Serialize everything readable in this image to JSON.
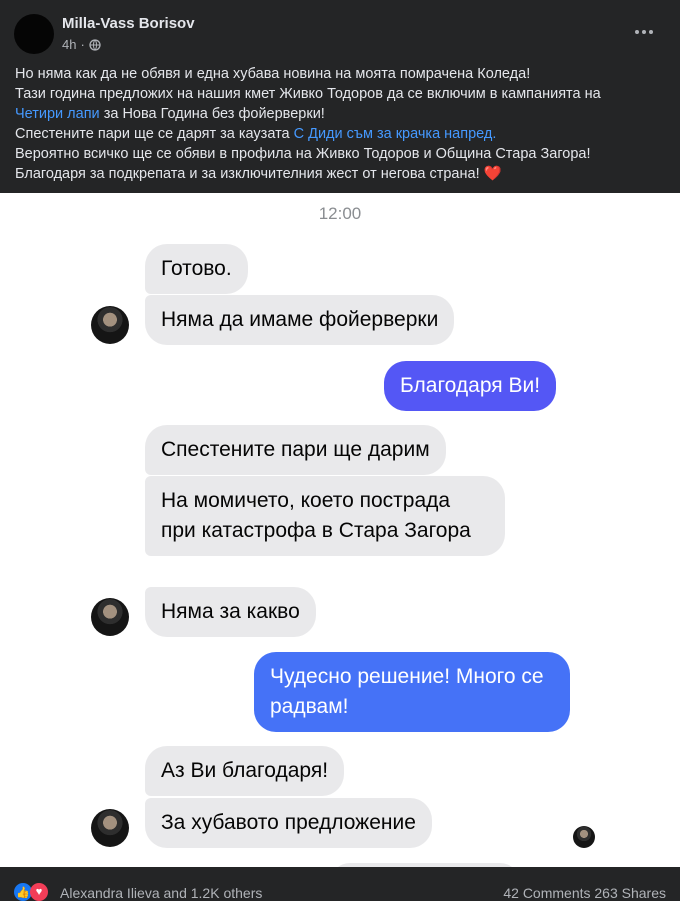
{
  "post": {
    "author": "Milla-Vass Borisov",
    "time": "4h",
    "privacy_icon": "globe-icon",
    "lines": [
      [
        "Но няма как да не обявя и една хубава новина на моята помрачена Коледа!"
      ],
      [
        "Тази година предложих на нашия кмет Живко Тодоров да се включим в кампанията на"
      ],
      [
        "Четири лапи",
        " за Нова Година без фойерверки!"
      ],
      [
        "Спестените пари ще се дарят за каузата ",
        "С Диди съм за крачка напред."
      ],
      [
        "Вероятно всичко ще се обяви в профила на Живко Тодоров и Община Стара Загора!"
      ],
      [
        "Благодаря за подкрепата и за изключителния жест от негова страна! "
      ]
    ],
    "heart": "❤️"
  },
  "chat": {
    "time": "12:00",
    "messages": [
      {
        "from": "them",
        "text": "Готово."
      },
      {
        "from": "them",
        "text": "Няма да имаме фойерверки"
      },
      {
        "from": "me",
        "text": "Благодаря Ви!"
      },
      {
        "from": "them",
        "text": "Спестените пари ще дарим"
      },
      {
        "from": "them",
        "text": "На момичето, което пострада при катастрофа в Стара Загора"
      },
      {
        "from": "them",
        "text": "Няма за какво"
      },
      {
        "from": "me",
        "text": "Чудесно решение! Много се радвам!"
      },
      {
        "from": "them",
        "text": "Аз Ви благодаря!"
      },
      {
        "from": "them",
        "text": "За хубавото предложение"
      }
    ],
    "colors": {
      "me_bubble_1": "#5457f5",
      "me_bubble_2": "#4572f7",
      "them_bubble": "#e9e9eb"
    }
  },
  "footer": {
    "reactors": "Alexandra Ilieva and 1.2K others",
    "counts": "42 Comments  263 Shares",
    "reaction_icons": [
      "like-icon",
      "love-icon"
    ]
  }
}
